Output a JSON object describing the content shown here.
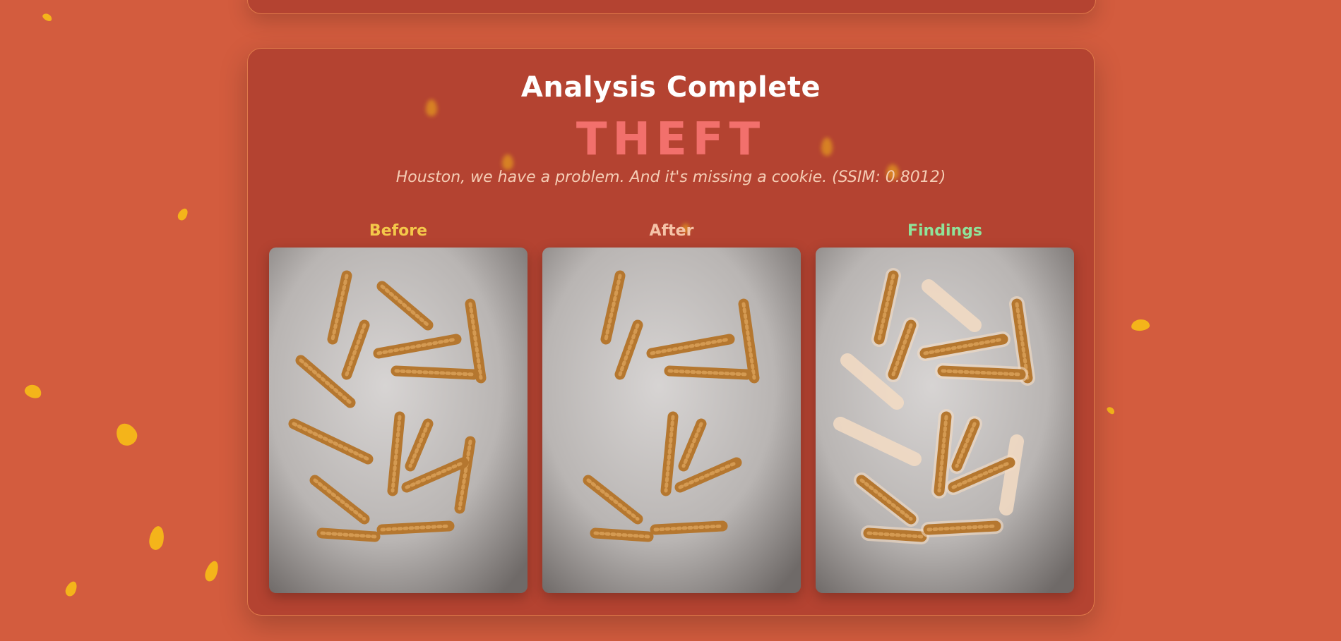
{
  "analysis": {
    "title": "Analysis Complete",
    "verdict": "THEFT",
    "message": "Houston, we have a problem. And it's missing a cookie. (SSIM: 0.8012)"
  },
  "panels": [
    {
      "label": "Before",
      "image": "before-snack-photo",
      "color": "#f4c84a"
    },
    {
      "label": "After",
      "image": "after-snack-photo",
      "color": "#f5c3a8"
    },
    {
      "label": "Findings",
      "image": "findings-overlay-photo",
      "color": "#8fe39a"
    }
  ],
  "colors": {
    "background": "#d35c3e",
    "card": "#b44331",
    "verdict": "#f2706c",
    "confetti": "#f4b41a",
    "snack": "#b5772f"
  }
}
